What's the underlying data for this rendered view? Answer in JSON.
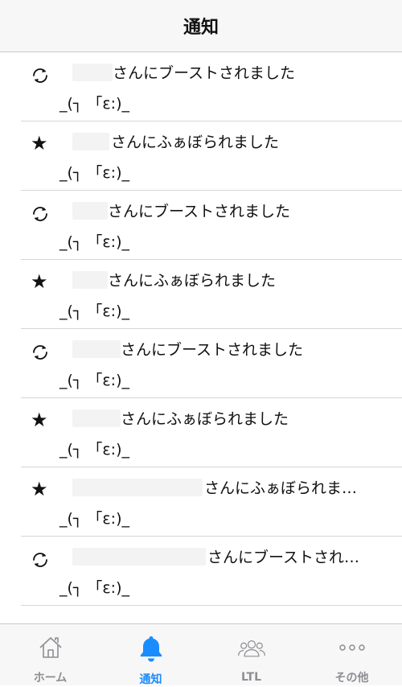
{
  "navbar": {
    "title": "通知"
  },
  "notifications": [
    {
      "type": "boost",
      "icon": "boost-icon",
      "message": "さんにブーストされました",
      "display": "_(┐ 「ε:)_"
    },
    {
      "type": "favourite",
      "icon": "star-icon",
      "message": "さんにふぁぼられました",
      "display": "_(┐ 「ε:)_"
    },
    {
      "type": "boost",
      "icon": "boost-icon",
      "message": "さんにブーストされました",
      "display": "_(┐ 「ε:)_"
    },
    {
      "type": "favourite",
      "icon": "star-icon",
      "message": "さんにふぁぼられました",
      "display": "_(┐ 「ε:)_"
    },
    {
      "type": "boost",
      "icon": "boost-icon",
      "message": "さんにブーストされました",
      "display": "_(┐ 「ε:)_"
    },
    {
      "type": "favourite",
      "icon": "star-icon",
      "message": "さんにふぁぼられました",
      "display": "_(┐ 「ε:)_"
    },
    {
      "type": "favourite",
      "icon": "star-icon",
      "message": "さんにふぁぼられま…",
      "display": "_(┐ 「ε:)_"
    },
    {
      "type": "boost",
      "icon": "boost-icon",
      "message": "さんにブーストされ…",
      "display": "_(┐ 「ε:)_"
    }
  ],
  "tabbar": {
    "items": [
      {
        "label": "ホーム",
        "icon": "home-icon",
        "active": false
      },
      {
        "label": "通知",
        "icon": "bell-icon",
        "active": true
      },
      {
        "label": "LTL",
        "icon": "people-icon",
        "active": false
      },
      {
        "label": "その他",
        "icon": "more-icon",
        "active": false
      }
    ]
  },
  "colors": {
    "accent": "#1a8cff",
    "inactive": "#8e8e93",
    "bar": "#f7f7f7"
  }
}
